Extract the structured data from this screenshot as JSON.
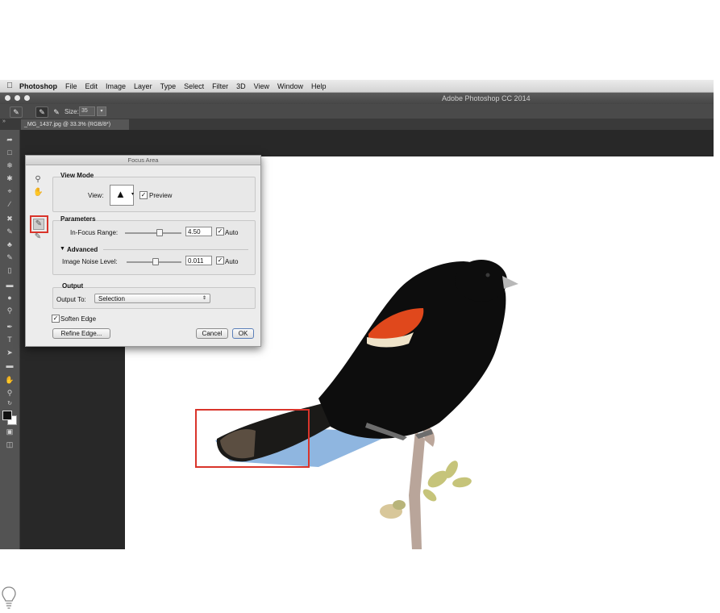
{
  "menubar": {
    "apple": "",
    "app_name": "Photoshop",
    "items": [
      "File",
      "Edit",
      "Image",
      "Layer",
      "Type",
      "Select",
      "Filter",
      "3D",
      "View",
      "Window",
      "Help"
    ]
  },
  "window": {
    "title": "Adobe Photoshop CC 2014"
  },
  "options_bar": {
    "size_label": "Size:",
    "size_value": "35"
  },
  "document_tab": {
    "label": "_MG_1437.jpg @ 33.3% (RGB/8*)"
  },
  "dialog": {
    "title": "Focus Area",
    "view_mode": {
      "heading": "View Mode",
      "view_label": "View:",
      "preview_label": "Preview",
      "preview_checked": true
    },
    "parameters": {
      "heading": "Parameters",
      "in_focus_label": "In-Focus Range:",
      "in_focus_value": "4.50",
      "in_focus_auto_label": "Auto",
      "in_focus_auto_checked": true,
      "advanced_label": "Advanced",
      "noise_label": "Image Noise Level:",
      "noise_value": "0.011",
      "noise_auto_label": "Auto",
      "noise_auto_checked": true
    },
    "output": {
      "heading": "Output",
      "output_to_label": "Output To:",
      "output_to_value": "Selection"
    },
    "soften_edge_label": "Soften Edge",
    "soften_edge_checked": true,
    "refine_edge_label": "Refine Edge...",
    "cancel_label": "Cancel",
    "ok_label": "OK"
  },
  "colors": {
    "highlight_red": "#d9342b",
    "selection_blue": "#8fb6e0",
    "workspace": "#282828"
  }
}
